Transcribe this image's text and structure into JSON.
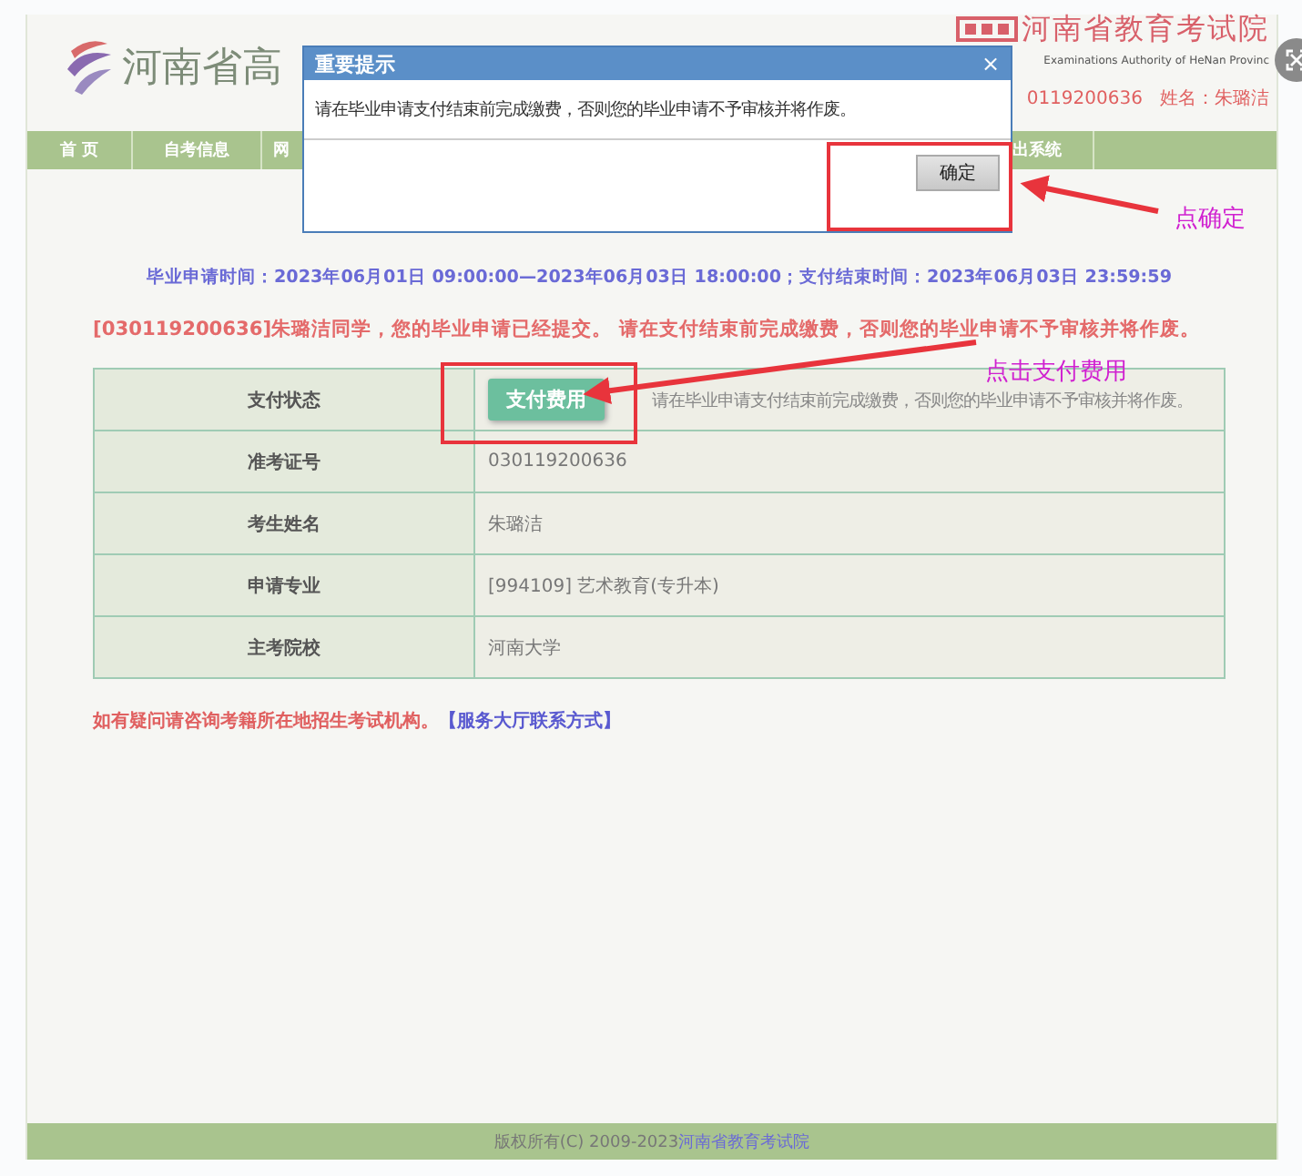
{
  "header": {
    "title": "河南省高",
    "authority_name": "河南省教育考试院",
    "authority_english": "Examinations Authority of HeNan Provinc",
    "user_info": "0119200636   姓名：朱璐洁"
  },
  "nav": [
    {
      "label": "首 页"
    },
    {
      "label": "自考信息"
    },
    {
      "label": "网"
    },
    {
      "label": "出系统"
    }
  ],
  "schedule": "毕业申请时间：2023年06月01日 09:00:00—2023年06月03日 18:00:00；支付结束时间：2023年06月03日 23:59:59",
  "notice": "[030119200636]朱璐洁同学，您的毕业申请已经提交。 请在支付结束前完成缴费，否则您的毕业申请不予审核并将作废。",
  "table": {
    "rows": [
      {
        "kind": "payment",
        "label": "支付状态",
        "button": "支付费用",
        "value": "请在毕业申请支付结束前完成缴费，否则您的毕业申请不予审核并将作废。"
      },
      {
        "kind": "text",
        "label": "准考证号",
        "value": "030119200636"
      },
      {
        "kind": "text",
        "label": "考生姓名",
        "value": "朱璐洁"
      },
      {
        "kind": "text",
        "label": "申请专业",
        "value": "[994109] 艺术教育(专升本)"
      },
      {
        "kind": "text",
        "label": "主考院校",
        "value": "河南大学"
      }
    ]
  },
  "help": {
    "text": "如有疑问请咨询考籍所在地招生考试机构。",
    "link": "【服务大厅联系方式】"
  },
  "footer": {
    "copyright": "版权所有(C) 2009-2023",
    "link": "河南省教育考试院"
  },
  "dialog": {
    "title": "重要提示",
    "close": "×",
    "message": "请在毕业申请支付结束前完成缴费，否则您的毕业申请不予审核并将作废。",
    "button": "确定"
  },
  "annotations": [
    {
      "label": "点确定"
    },
    {
      "label": "点击支付费用"
    }
  ]
}
